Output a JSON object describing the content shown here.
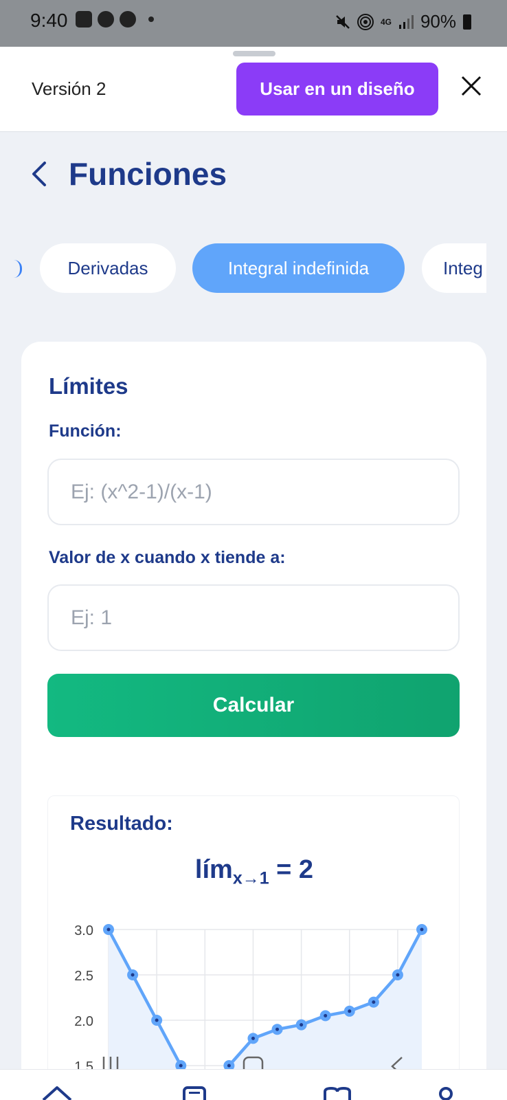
{
  "status_bar": {
    "time": "9:40",
    "battery": "90%",
    "network": "4G"
  },
  "header": {
    "version": "Versión 2",
    "use_button": "Usar en un diseño"
  },
  "page": {
    "title": "Funciones"
  },
  "tabs": [
    {
      "label": "Derivadas",
      "active": false
    },
    {
      "label": "Integral indefinida",
      "active": true
    },
    {
      "label": "Integ",
      "active": false
    }
  ],
  "card": {
    "title": "Límites",
    "function_label": "Función:",
    "function_placeholder": "Ej: (x^2-1)/(x-1)",
    "value_label": "Valor de x cuando x tiende a:",
    "value_placeholder": "Ej: 1",
    "calculate_button": "Calcular",
    "result_label": "Resultado:",
    "result_main": "lím",
    "result_sub": "x→1",
    "result_value": " = 2"
  },
  "colors": {
    "accent_purple": "#8b3cf7",
    "title_blue": "#1e3a8a",
    "tab_active": "#60a5fa",
    "button_green": "#10b981",
    "line_blue": "#60a5fa"
  },
  "icons": {
    "close": "close-icon",
    "back": "chevron-left-icon",
    "nav": [
      "home-icon",
      "calculator-icon",
      "book-icon",
      "user-icon"
    ]
  },
  "chart_data": {
    "type": "line",
    "x": [
      0,
      1,
      2,
      3,
      4,
      5,
      6,
      7,
      8,
      9,
      10,
      11,
      12,
      13
    ],
    "values": [
      3.0,
      2.5,
      2.0,
      1.5,
      null,
      1.5,
      1.8,
      1.9,
      1.95,
      2.05,
      2.1,
      2.2,
      2.5,
      3.0
    ],
    "y_ticks": [
      "3.0",
      "2.5",
      "2.0",
      "1.5"
    ],
    "ylim": [
      1.5,
      3.0
    ],
    "grid": true,
    "fill": true
  }
}
